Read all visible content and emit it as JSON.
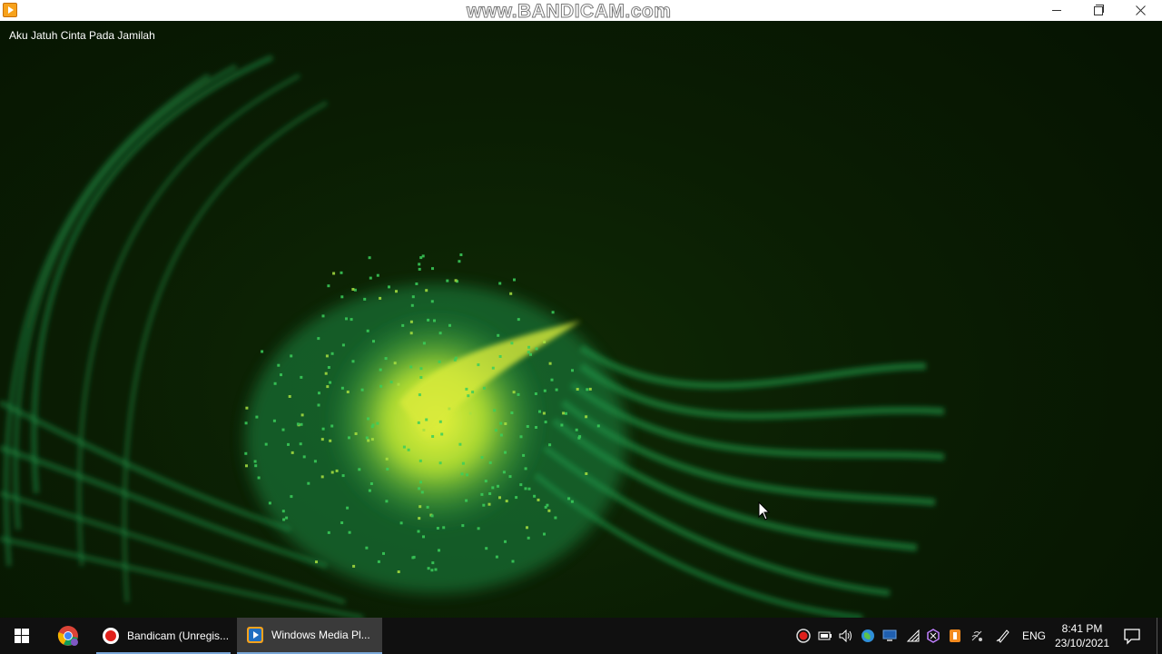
{
  "window": {
    "watermark": "www.BANDICAM.com",
    "video_title": "Aku Jatuh Cinta Pada Jamilah"
  },
  "taskbar": {
    "apps": [
      {
        "name": "chrome",
        "icon": "chrome-icon"
      },
      {
        "name": "bandicam",
        "label": "Bandicam (Unregis...",
        "icon": "record-icon"
      },
      {
        "name": "windows-media-player",
        "label": "Windows Media Pl...",
        "icon": "media-player-icon",
        "active": true
      }
    ],
    "tray": {
      "language": "ENG",
      "time": "8:41 PM",
      "date": "23/10/2021"
    }
  },
  "colors": {
    "accent": "#7aa7d8",
    "visualization_green": "#1e9a4a",
    "visualization_yellow": "#e6f03a",
    "record_red": "#e0201b"
  }
}
